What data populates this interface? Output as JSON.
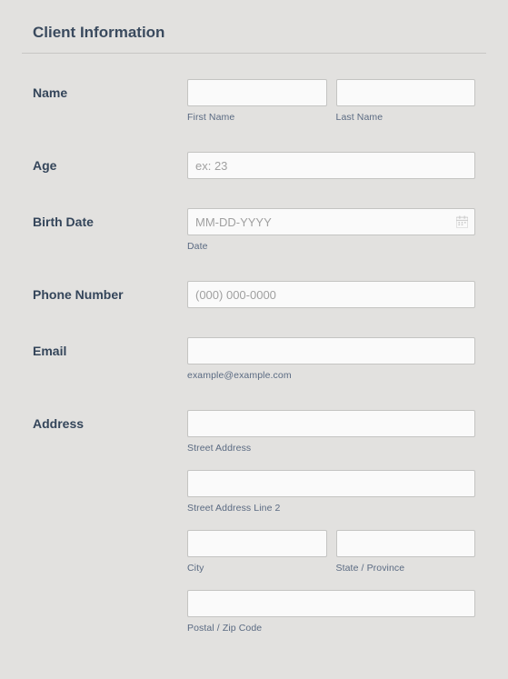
{
  "section": {
    "title": "Client Information"
  },
  "fields": {
    "name": {
      "label": "Name",
      "first_sublabel": "First Name",
      "last_sublabel": "Last Name"
    },
    "age": {
      "label": "Age",
      "placeholder": "ex: 23"
    },
    "birthdate": {
      "label": "Birth Date",
      "placeholder": "MM-DD-YYYY",
      "sublabel": "Date"
    },
    "phone": {
      "label": "Phone Number",
      "placeholder": "(000) 000-0000"
    },
    "email": {
      "label": "Email",
      "sublabel": "example@example.com"
    },
    "address": {
      "label": "Address",
      "street_sublabel": "Street Address",
      "street2_sublabel": "Street Address Line 2",
      "city_sublabel": "City",
      "state_sublabel": "State / Province",
      "postal_sublabel": "Postal / Zip Code"
    }
  }
}
